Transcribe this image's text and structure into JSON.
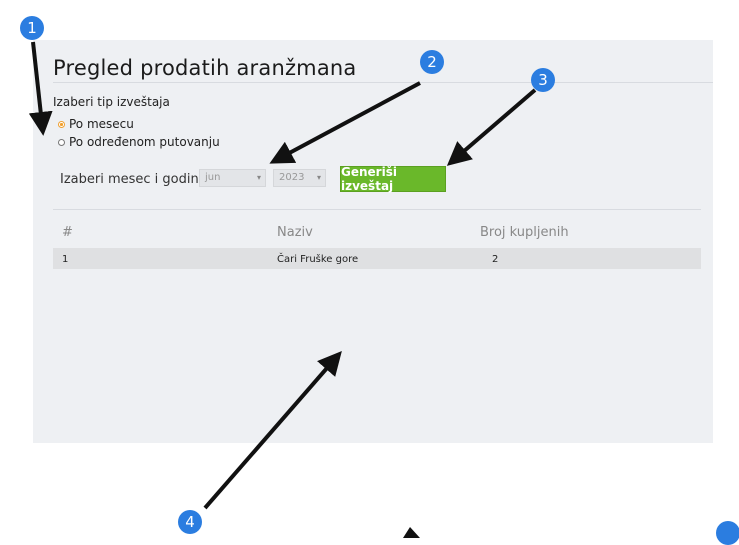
{
  "page": {
    "title": "Pregled prodatih aranžmana"
  },
  "report_type": {
    "label": "Izaberi tip izveštaja",
    "options": [
      {
        "label": "Po mesecu",
        "selected": true
      },
      {
        "label": "Po određenom putovanju",
        "selected": false
      }
    ]
  },
  "filters": {
    "label": "Izaberi mesec i godinu",
    "month": "jun",
    "year": "2023",
    "generate_label": "Generiši izveštaj"
  },
  "table": {
    "headers": [
      "#",
      "Naziv",
      "Broj kupljenih"
    ],
    "rows": [
      [
        "1",
        "Čari Fruške gore",
        "2"
      ]
    ]
  },
  "annotations": {
    "markers": [
      "1",
      "2",
      "3",
      "4"
    ],
    "color": "#2b7de0"
  },
  "colors": {
    "accent_button": "#6ab82a",
    "selected_radio": "#f0a030",
    "panel_bg": "#eef0f3"
  }
}
